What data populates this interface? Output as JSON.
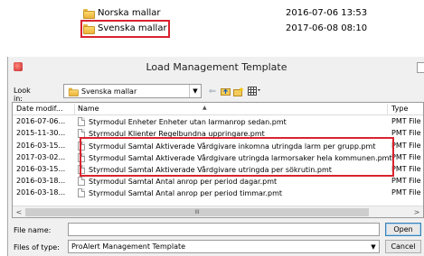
{
  "top_list": {
    "rows": [
      {
        "name": "Norska mallar",
        "date": "2016-07-06 13:53"
      },
      {
        "name": "Svenska mallar",
        "date": "2017-06-08 08:10"
      }
    ]
  },
  "dialog": {
    "title": "Load Management Template",
    "look_in_label": "Look in:",
    "look_in_value": "Svenska mallar",
    "columns": {
      "date": "Date modif...",
      "name": "Name",
      "type": "Type"
    },
    "files": [
      {
        "date": "2016-07-06...",
        "name": "Styrmodul Enheter Enheter utan larmanrop sedan.pmt",
        "type": "PMT File"
      },
      {
        "date": "2015-11-30...",
        "name": "Styrmodul Klienter Regelbundna uppringare.pmt",
        "type": "PMT File"
      },
      {
        "date": "2016-03-15...",
        "name": "Styrmodul Samtal Aktiverade Vårdgivare inkomna utringda larm per grupp.pmt",
        "type": "PMT File"
      },
      {
        "date": "2017-03-02...",
        "name": "Styrmodul Samtal Aktiverade Vårdgivare utringda larmorsaker hela kommunen.pmt",
        "type": "PMT File"
      },
      {
        "date": "2016-03-15...",
        "name": "Styrmodul Samtal Aktiverade Vårdgivare utringda per sökrutin.pmt",
        "type": "PMT File"
      },
      {
        "date": "2016-03-18...",
        "name": "Styrmodul Samtal Antal anrop per period dagar.pmt",
        "type": "PMT File"
      },
      {
        "date": "2016-03-18...",
        "name": "Styrmodul Samtal Antal anrop per period timmar.pmt",
        "type": "PMT File"
      }
    ],
    "scroll_thumb_glyph": "III",
    "file_name_label": "File name:",
    "file_name_value": "",
    "files_of_type_label": "Files of type:",
    "files_of_type_value": "ProAlert Management Template",
    "open_button": "Open",
    "cancel_button": "Cancel"
  },
  "colors": {
    "highlight_border": "#d9232e",
    "dialog_bg": "#f0f0f0"
  },
  "icons": [
    "folder-icon",
    "document-icon",
    "back-arrow-icon",
    "up-folder-icon",
    "new-folder-icon",
    "view-menu-icon",
    "app-icon"
  ]
}
